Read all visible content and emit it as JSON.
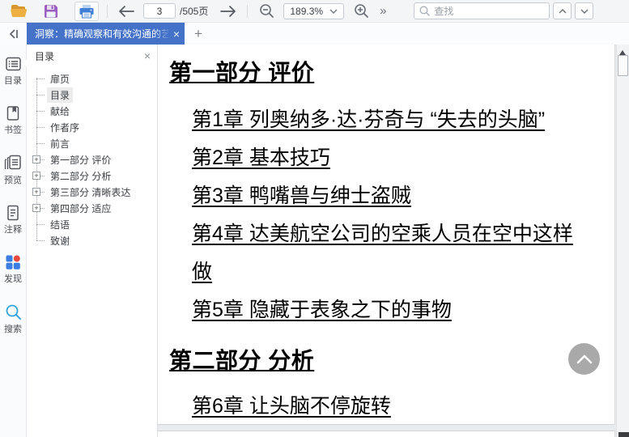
{
  "toolbar": {
    "page_number": "3",
    "page_total": "/505页",
    "zoom_level": "189.3%",
    "more_glyph": "»",
    "search_placeholder": "查找"
  },
  "tabbar": {
    "active_tab": "洞察：精确观察和有效沟通的艺",
    "close_glyph": "×",
    "new_tab_glyph": "+"
  },
  "sidebar": {
    "items": [
      {
        "label": "目录",
        "icon": "toc-icon",
        "active": true
      },
      {
        "label": "书签",
        "icon": "bookmark-icon",
        "active": false
      },
      {
        "label": "预览",
        "icon": "preview-icon",
        "active": false
      },
      {
        "label": "注释",
        "icon": "annotation-icon",
        "active": false
      },
      {
        "label": "发现",
        "icon": "discover-icon",
        "active": false
      },
      {
        "label": "搜索",
        "icon": "search-icon",
        "active": false
      }
    ]
  },
  "outline_panel": {
    "title": "目录",
    "close_glyph": "×",
    "expand_glyph": "+",
    "items": [
      {
        "label": "扉页",
        "type": "leaf",
        "selected": false
      },
      {
        "label": "目录",
        "type": "leaf",
        "selected": true
      },
      {
        "label": "献给",
        "type": "leaf",
        "selected": false
      },
      {
        "label": "作者序",
        "type": "leaf",
        "selected": false
      },
      {
        "label": "前言",
        "type": "leaf",
        "selected": false
      },
      {
        "label": "第一部分 评价",
        "type": "expandable",
        "selected": false
      },
      {
        "label": "第二部分 分析",
        "type": "expandable",
        "selected": false
      },
      {
        "label": "第三部分 清晰表达",
        "type": "expandable",
        "selected": false
      },
      {
        "label": "第四部分 适应",
        "type": "expandable",
        "selected": false
      },
      {
        "label": "结语",
        "type": "leaf",
        "selected": false
      },
      {
        "label": "致谢",
        "type": "leaf",
        "selected": false
      }
    ]
  },
  "document": {
    "sections": [
      {
        "heading": "第一部分 评价",
        "chapters": [
          "第1章 列奥纳多·达·芬奇与 “失去的头脑”",
          "第2章 基本技巧",
          "第3章 鸭嘴兽与绅士盗贼",
          "第4章 达美航空公司的空乘人员在空中这样做",
          "第5章 隐藏于表象之下的事物"
        ]
      },
      {
        "heading": "第二部分 分析",
        "chapters": [
          "第6章 让头脑不停旋转"
        ]
      }
    ]
  },
  "colors": {
    "tab_active_blue": "#4472c8",
    "folder_yellow": "#e9a83a",
    "save_purple": "#9a5fc0",
    "printer_blue": "#3f7fd6",
    "discover_blue": "#3b7de0",
    "discover_red": "#e8493f",
    "search_blue": "#35a3dc",
    "back_to_top_gray": "#a9a9a9"
  }
}
